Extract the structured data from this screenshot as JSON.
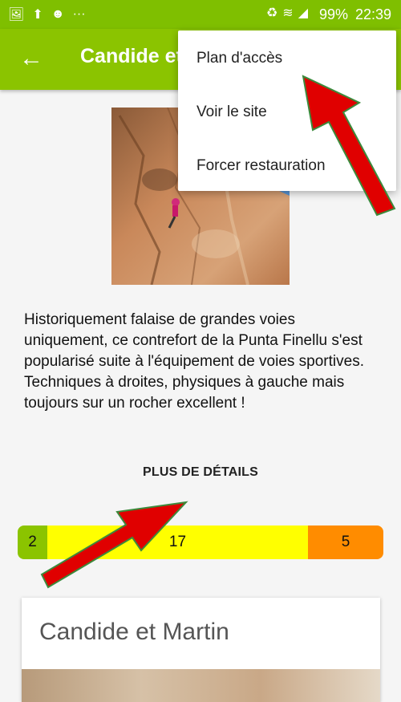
{
  "status_bar": {
    "left_icons": [
      "image-icon",
      "upload-icon",
      "smiley-icon",
      "more-dots-icon"
    ],
    "battery_percent": "99%",
    "time": "22:39"
  },
  "app_bar": {
    "title": "Candide et Martin",
    "back_icon": "arrow-left-icon"
  },
  "overflow_menu": {
    "items": [
      {
        "label": "Plan d'accès"
      },
      {
        "label": "Voir le site"
      },
      {
        "label": "Forcer restauration"
      }
    ]
  },
  "description": "Historiquement falaise de grandes voies uniquement, ce contrefort de la Punta Finellu s'est popularisé suite à l'équipement de voies sportives. Techniques à droites, physiques à gauche mais toujours sur un rocher excellent !",
  "details_button": "PLUS DE DÉTAILS",
  "difficulty_bar": {
    "segments": [
      {
        "count": "2",
        "color": "#8bc400"
      },
      {
        "count": "17",
        "color": "#ffff00"
      },
      {
        "count": "5",
        "color": "#ff8c00"
      }
    ]
  },
  "sector_card": {
    "title": "Candide et Martin"
  },
  "colors": {
    "app_bar": "#8bc400",
    "status_bar": "#7fbf00",
    "annotation_arrow": "#e00000"
  }
}
